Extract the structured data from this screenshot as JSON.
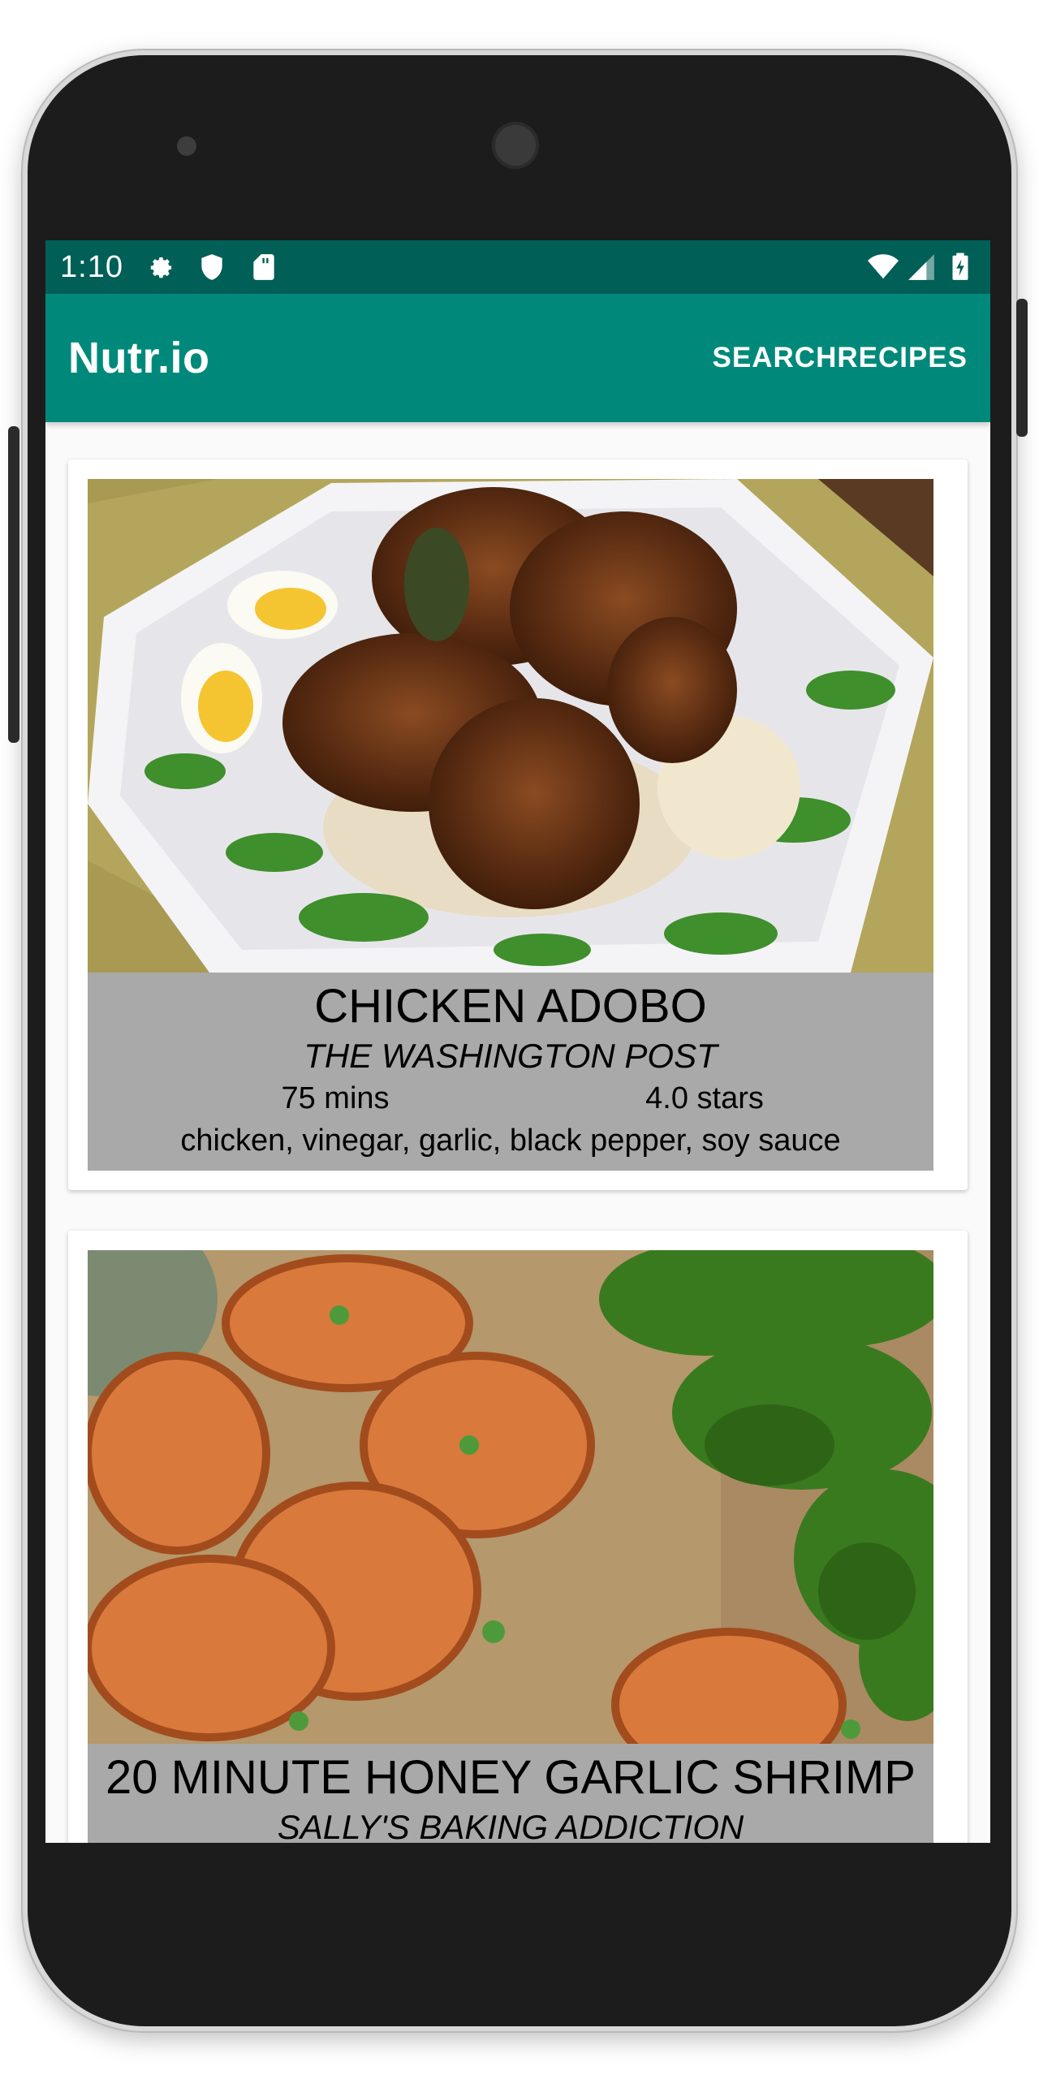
{
  "status_bar": {
    "time": "1:10",
    "left_icons": [
      "settings-icon",
      "shield-icon",
      "sd-card-icon"
    ],
    "right_icons": [
      "wifi-icon",
      "signal-icon",
      "battery-icon"
    ]
  },
  "app_bar": {
    "title": "Nutr.io",
    "action_label": "SEARCHRECIPES"
  },
  "recipes": [
    {
      "title": "CHICKEN ADOBO",
      "source": "THE WASHINGTON POST",
      "time": "75 mins",
      "rating": "4.0 stars",
      "ingredients": "chicken, vinegar, garlic, black pepper, soy sauce"
    },
    {
      "title": "20 MINUTE HONEY GARLIC SHRIMP",
      "source": "SALLY'S BAKING ADDICTION"
    }
  ],
  "colors": {
    "status_bar": "#005f56",
    "app_bar": "#00897b",
    "card_info_background": "#a9a9a9"
  }
}
